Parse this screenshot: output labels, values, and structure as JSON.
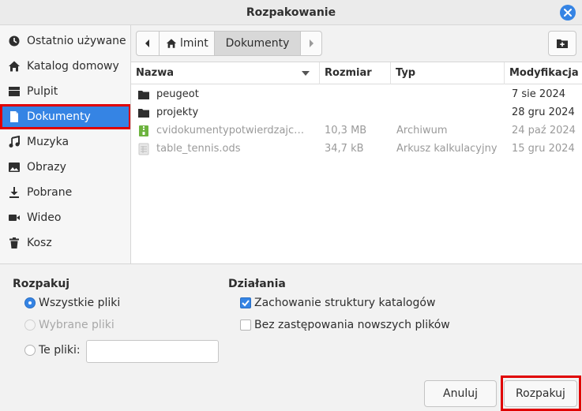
{
  "window": {
    "title": "Rozpakowanie"
  },
  "sidebar": {
    "items": [
      {
        "label": "Ostatnio używane",
        "icon": "clock-icon"
      },
      {
        "label": "Katalog domowy",
        "icon": "home-icon"
      },
      {
        "label": "Pulpit",
        "icon": "desktop-icon"
      },
      {
        "label": "Dokumenty",
        "icon": "document-icon",
        "active": true
      },
      {
        "label": "Muzyka",
        "icon": "music-icon"
      },
      {
        "label": "Obrazy",
        "icon": "image-icon"
      },
      {
        "label": "Pobrane",
        "icon": "download-icon"
      },
      {
        "label": "Wideo",
        "icon": "video-icon"
      },
      {
        "label": "Kosz",
        "icon": "trash-icon"
      }
    ]
  },
  "pathbar": {
    "segments": [
      "lmint",
      "Dokumenty"
    ]
  },
  "filelist": {
    "columns": [
      "Nazwa",
      "Rozmiar",
      "Typ",
      "Modyfikacja"
    ],
    "rows": [
      {
        "name": "peugeot",
        "size": "",
        "type": "",
        "modified": "7 sie 2024",
        "kind": "folder"
      },
      {
        "name": "projekty",
        "size": "",
        "type": "",
        "modified": "28 gru 2024",
        "kind": "folder"
      },
      {
        "name": "cvidokumentypotwierdzajc…",
        "size": "10,3 MB",
        "type": "Archiwum",
        "modified": "24 paź 2024",
        "kind": "archive"
      },
      {
        "name": "table_tennis.ods",
        "size": "34,7 kB",
        "type": "Arkusz kalkulacyjny",
        "modified": "15 gru 2024",
        "kind": "spreadsheet"
      }
    ]
  },
  "extract": {
    "heading": "Rozpakuj",
    "options": [
      "Wszystkie pliki",
      "Wybrane pliki",
      "Te pliki:"
    ],
    "selected": "Wszystkie pliki",
    "files_value": ""
  },
  "actions": {
    "heading": "Działania",
    "keep_structure": "Zachowanie struktury katalogów",
    "keep_structure_checked": true,
    "no_overwrite": "Bez zastępowania nowszych plików",
    "no_overwrite_checked": false
  },
  "buttons": {
    "cancel": "Anuluj",
    "extract": "Rozpakuj"
  },
  "colors": {
    "accent": "#3584e4",
    "highlight": "#e00000"
  }
}
